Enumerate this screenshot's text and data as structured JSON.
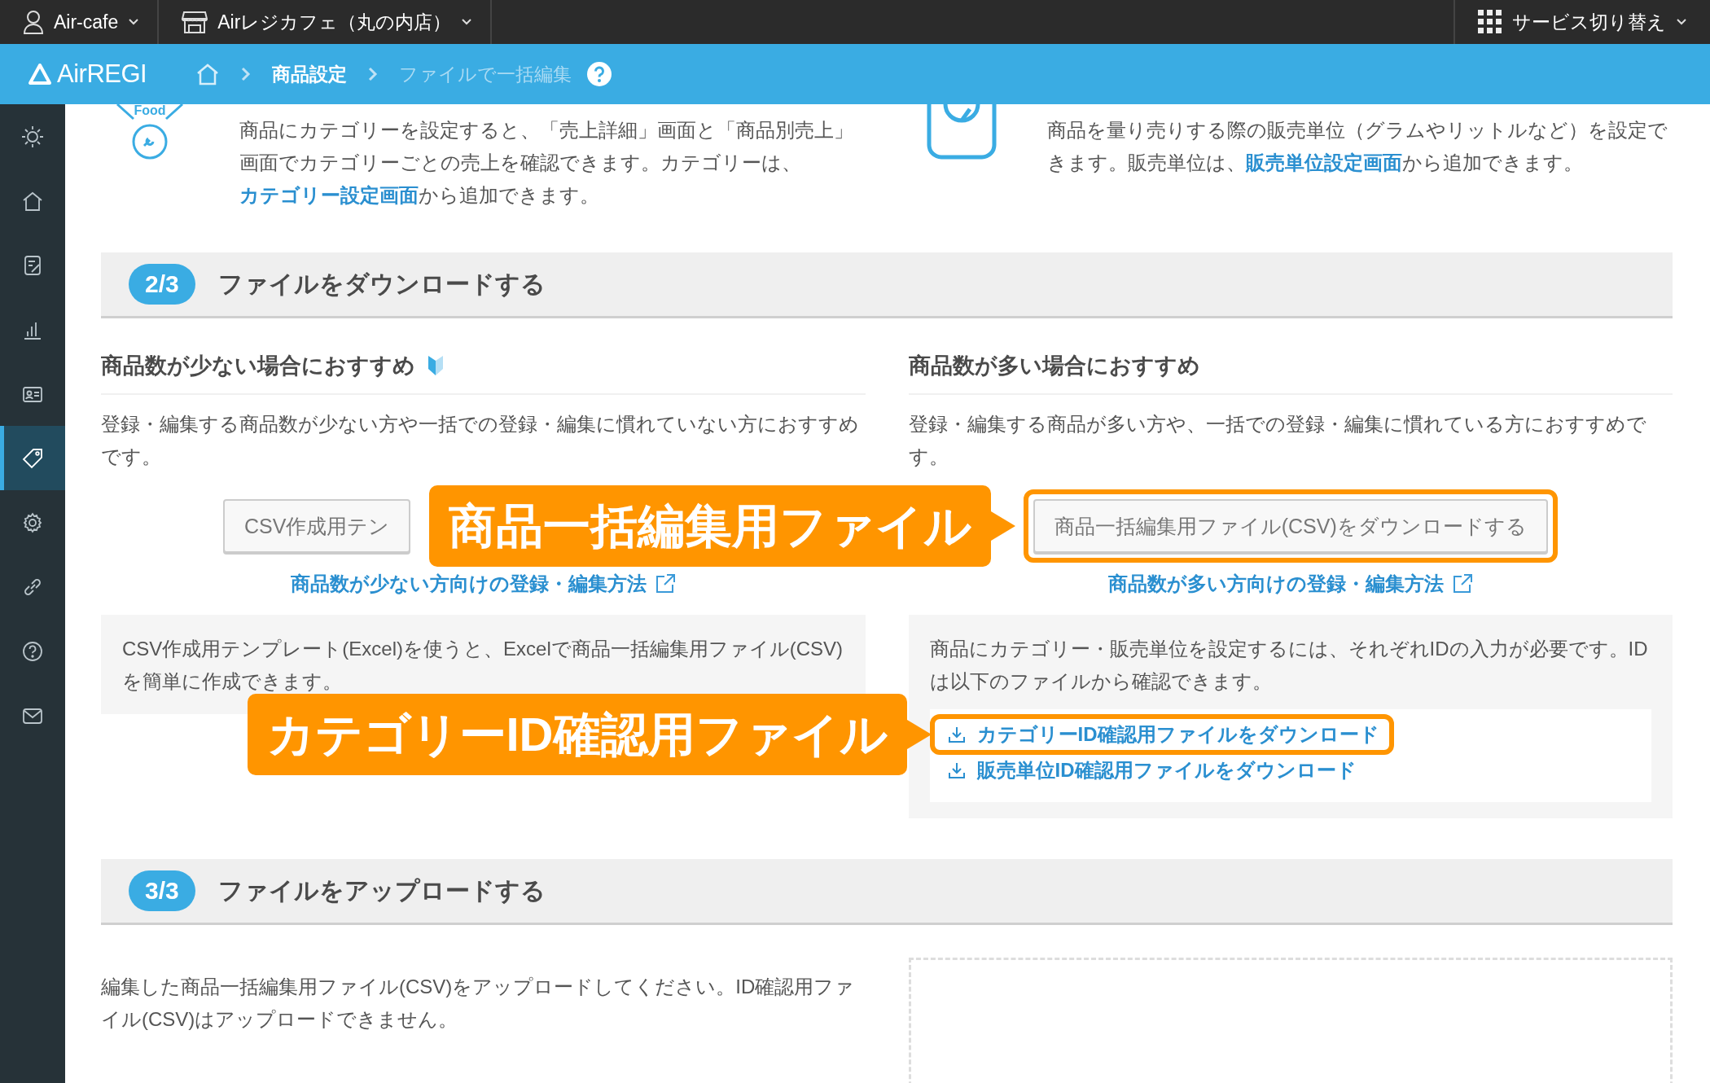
{
  "top_bar": {
    "account": "Air-cafe",
    "store": "Airレジカフェ（丸の内店）",
    "service_switch": "サービス切り替え"
  },
  "header": {
    "logo": "AirREGI",
    "breadcrumb": [
      {
        "label": "商品設定",
        "current": false
      },
      {
        "label": "ファイルで一括編集",
        "current": true
      }
    ]
  },
  "sidebar": {
    "items": [
      {
        "selected": false
      },
      {
        "selected": false
      },
      {
        "selected": false
      },
      {
        "selected": false
      },
      {
        "selected": false
      },
      {
        "selected": true
      },
      {
        "selected": false
      },
      {
        "selected": false
      },
      {
        "selected": false
      },
      {
        "selected": false
      }
    ]
  },
  "intro": [
    {
      "icon_label": "Food",
      "text_before": "商品にカテゴリーを設定すると、「売上詳細」画面と「商品別売上」画面でカテゴリーごとの売上を確認できます。カテゴリーは、",
      "link": "カテゴリー設定画面",
      "text_after": "から追加できます。"
    },
    {
      "text_before": "商品を量り売りする際の販売単位（グラムやリットルなど）を設定できます。販売単位は、",
      "link": "販売単位設定画面",
      "text_after": "から追加できます。"
    }
  ],
  "steps": [
    {
      "kind": "download",
      "badge": "2/3",
      "title": "ファイルをダウンロードする",
      "columns": [
        {
          "heading": "商品数が少ない場合におすすめ",
          "beginner_mark": true,
          "description": "登録・編集する商品数が少ない方や一括での登録・編集に慣れていない方におすすめです。",
          "button": {
            "label": "CSV作成用テン",
            "highlighted": false
          },
          "guide_link": "商品数が少ない方向けの登録・編集方法",
          "note": {
            "text": "CSV作成用テンプレート(Excel)を使うと、Excelで商品一括編集用ファイル(CSV)を簡単に作成できます。"
          }
        },
        {
          "heading": "商品数が多い場合におすすめ",
          "beginner_mark": false,
          "description": "登録・編集する商品が多い方や、一括での登録・編集に慣れている方におすすめです。",
          "button": {
            "label": "商品一括編集用ファイル(CSV)をダウンロードする",
            "highlighted": true,
            "callout": "商品一括編集用ファイル"
          },
          "guide_link": "商品数が多い方向けの登録・編集方法",
          "note": {
            "text": "商品にカテゴリー・販売単位を設定するには、それぞれIDの入力が必要です。IDは以下のファイルから確認できます。",
            "downloads": [
              {
                "label": "カテゴリーID確認用ファイルをダウンロード",
                "highlighted": true,
                "callout": "カテゴリーID確認用ファイル"
              },
              {
                "label": "販売単位ID確認用ファイルをダウンロード",
                "highlighted": false
              }
            ]
          }
        }
      ]
    },
    {
      "kind": "upload",
      "badge": "3/3",
      "title": "ファイルをアップロードする",
      "description": "編集した商品一括編集用ファイル(CSV)をアップロードしてください。ID確認用ファイル(CSV)はアップロードできません。"
    }
  ]
}
